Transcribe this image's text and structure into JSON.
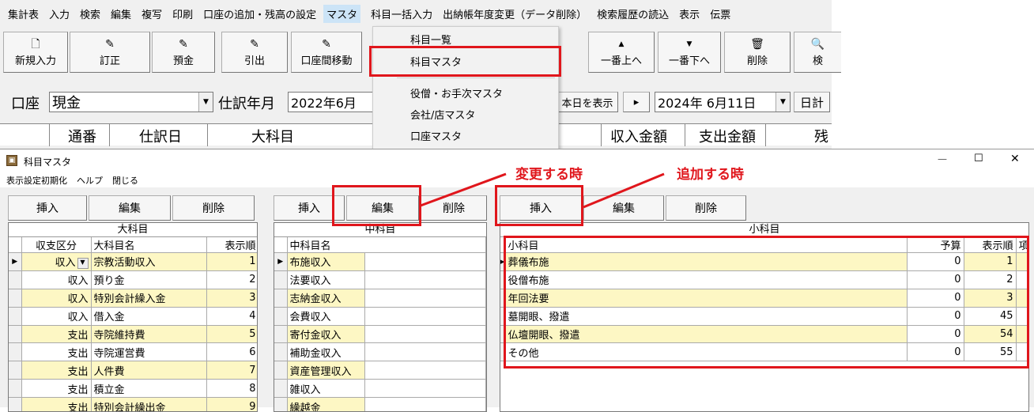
{
  "menubar": {
    "items": [
      "集計表",
      "入力",
      "検索",
      "編集",
      "複写",
      "印刷",
      "口座の追加・残高の設定",
      "マスタ",
      "科目一括入力",
      "出納帳年度変更（データ削除）",
      "検索履歴の読込",
      "表示",
      "伝票"
    ]
  },
  "toolbar": {
    "buttons": [
      {
        "label": "新規入力",
        "icon": "🗋"
      },
      {
        "label": "訂正",
        "icon": "✎"
      },
      {
        "label": "預金",
        "icon": "✎"
      },
      {
        "label": "引出",
        "icon": "✎"
      },
      {
        "label": "口座間移動",
        "icon": "✎"
      },
      {
        "label": "一番上へ",
        "icon": "▲"
      },
      {
        "label": "一番下へ",
        "icon": "▼"
      },
      {
        "label": "削除",
        "icon": "🗑"
      },
      {
        "label": "検",
        "icon": "🔍"
      }
    ]
  },
  "account": {
    "label": "口座",
    "value": "現金",
    "period_label": "仕訳年月",
    "period_value": "2022年6月",
    "show_today": "本日を表示",
    "next_arrow": "▸",
    "date_value": "2024年  6月11日",
    "daily_total": "日計"
  },
  "bg_grid_headers": [
    "通番",
    "仕訳日",
    "大科目",
    "収入金額",
    "支出金額",
    "残"
  ],
  "dropdown": {
    "items": [
      "科目一覧",
      "科目マスタ",
      "役僧・お手次マスタ",
      "会社/店マスタ",
      "口座マスタ"
    ]
  },
  "window": {
    "title": "科目マスタ",
    "menu": [
      "表示設定初期化",
      "ヘルプ",
      "閉じる"
    ],
    "controls": {
      "minimize": "—",
      "maximize": "☐",
      "close": "✕"
    }
  },
  "panel_large": {
    "buttons": [
      "挿入",
      "編集",
      "削除"
    ],
    "title": "大科目",
    "headers": [
      "収支区分",
      "大科目名",
      "表示順"
    ],
    "rows": [
      {
        "kubun": "収入",
        "name": "宗教活動収入",
        "order": "1"
      },
      {
        "kubun": "収入",
        "name": "預り金",
        "order": "2"
      },
      {
        "kubun": "収入",
        "name": "特別会計繰入金",
        "order": "3"
      },
      {
        "kubun": "収入",
        "name": "借入金",
        "order": "4"
      },
      {
        "kubun": "支出",
        "name": "寺院維持費",
        "order": "5"
      },
      {
        "kubun": "支出",
        "name": "寺院運営費",
        "order": "6"
      },
      {
        "kubun": "支出",
        "name": "人件費",
        "order": "7"
      },
      {
        "kubun": "支出",
        "name": "積立金",
        "order": "8"
      },
      {
        "kubun": "支出",
        "name": "特別会計繰出金",
        "order": "9"
      }
    ]
  },
  "panel_mid": {
    "buttons": [
      "挿入",
      "編集",
      "削除"
    ],
    "title": "中科目",
    "headers": [
      "中科目名"
    ],
    "rows": [
      "布施収入",
      "法要収入",
      "志納金収入",
      "会費収入",
      "寄付金収入",
      "補助金収入",
      "資産管理収入",
      "雑収入",
      "繰越金"
    ]
  },
  "panel_small": {
    "buttons": [
      "挿入",
      "編集",
      "削除"
    ],
    "title": "小科目",
    "headers": [
      "小科目",
      "予算",
      "表示順",
      "項"
    ],
    "rows": [
      {
        "name": "葬儀布施",
        "budget": "0",
        "order": "1"
      },
      {
        "name": "役僧布施",
        "budget": "0",
        "order": "2"
      },
      {
        "name": "年回法要",
        "budget": "0",
        "order": "3"
      },
      {
        "name": "墓開眼、撥遣",
        "budget": "0",
        "order": "45"
      },
      {
        "name": "仏壇開眼、撥遣",
        "budget": "0",
        "order": "54"
      },
      {
        "name": "その他",
        "budget": "0",
        "order": "55"
      }
    ]
  },
  "annotations": {
    "change": "変更する時",
    "add": "追加する時",
    "color": "#e0161c"
  }
}
